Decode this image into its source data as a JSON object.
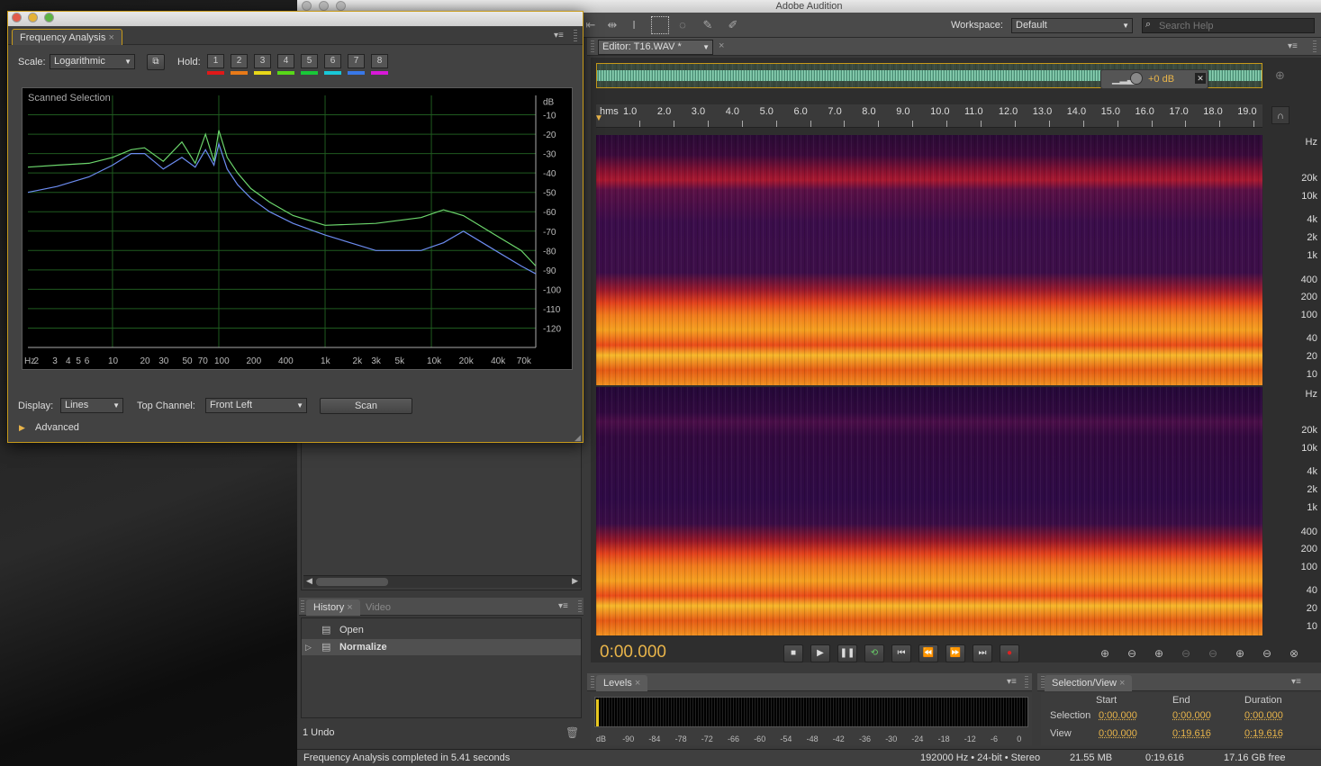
{
  "app": {
    "title": "Adobe Audition"
  },
  "toolbar": {
    "workspace_label": "Workspace:",
    "workspace_value": "Default",
    "search_placeholder": "Search Help"
  },
  "freq": {
    "title": "Frequency Analysis",
    "scale_label": "Scale:",
    "scale_value": "Logarithmic",
    "hold_label": "Hold:",
    "holds": [
      {
        "n": "1",
        "color": "#e01818"
      },
      {
        "n": "2",
        "color": "#e87a18"
      },
      {
        "n": "3",
        "color": "#e8d818"
      },
      {
        "n": "4",
        "color": "#58d818"
      },
      {
        "n": "5",
        "color": "#18c838"
      },
      {
        "n": "6",
        "color": "#18c8d8"
      },
      {
        "n": "7",
        "color": "#3878e8"
      },
      {
        "n": "8",
        "color": "#d818d8"
      }
    ],
    "graph_caption": "Scanned Selection",
    "display_label": "Display:",
    "display_value": "Lines",
    "top_channel_label": "Top Channel:",
    "top_channel_value": "Front Left",
    "scan_label": "Scan",
    "advanced_label": "Advanced"
  },
  "chart_data": {
    "type": "line",
    "title": "Scanned Selection",
    "xlabel": "Hz",
    "ylabel": "dB",
    "xscale": "log",
    "xlim": [
      1.6,
      96000
    ],
    "ylim": [
      -130,
      0
    ],
    "x_ticks": [
      "Hz",
      "2",
      "3",
      "4",
      "5",
      "6",
      "10",
      "20",
      "30",
      "50",
      "70",
      "100",
      "200",
      "400",
      "1k",
      "2k",
      "3k",
      "5k",
      "10k",
      "20k",
      "40k",
      "70k"
    ],
    "y_ticks": [
      "dB",
      "-10",
      "-20",
      "-30",
      "-40",
      "-50",
      "-60",
      "-70",
      "-80",
      "-90",
      "-100",
      "-110",
      "-120"
    ],
    "series": [
      {
        "color": "#6cd66c",
        "x": [
          1.6,
          3,
          6,
          10,
          15,
          20,
          30,
          45,
          60,
          75,
          90,
          100,
          120,
          150,
          200,
          300,
          500,
          1000,
          3000,
          8000,
          13000,
          20000,
          40000,
          70000,
          96000
        ],
        "y": [
          -37,
          -36,
          -35,
          -32,
          -28,
          -27,
          -34,
          -24,
          -35,
          -20,
          -34,
          -18,
          -32,
          -40,
          -48,
          -55,
          -62,
          -67,
          -66,
          -63,
          -59,
          -62,
          -72,
          -80,
          -88
        ]
      },
      {
        "color": "#6c8cf0",
        "x": [
          1.6,
          3,
          6,
          10,
          15,
          20,
          30,
          45,
          60,
          75,
          90,
          100,
          120,
          150,
          200,
          300,
          500,
          1000,
          3000,
          8000,
          13000,
          20000,
          40000,
          70000,
          96000
        ],
        "y": [
          -50,
          -47,
          -42,
          -36,
          -30,
          -30,
          -38,
          -32,
          -37,
          -28,
          -36,
          -25,
          -38,
          -46,
          -53,
          -60,
          -66,
          -72,
          -80,
          -80,
          -76,
          -70,
          -80,
          -88,
          -92
        ]
      }
    ]
  },
  "history": {
    "tabs": [
      "History",
      "Video"
    ],
    "items": [
      "Open",
      "Normalize"
    ],
    "undo_text": "1 Undo"
  },
  "editor": {
    "tab_label": "Editor: T16.WAV *",
    "gain_text": "+0 dB",
    "ruler_unit": "hms",
    "ruler_ticks": [
      "1.0",
      "2.0",
      "3.0",
      "4.0",
      "5.0",
      "6.0",
      "7.0",
      "8.0",
      "9.0",
      "10.0",
      "11.0",
      "12.0",
      "13.0",
      "14.0",
      "15.0",
      "16.0",
      "17.0",
      "18.0",
      "19.0"
    ],
    "hz_ticks": [
      "Hz",
      "20k",
      "10k",
      "4k",
      "2k",
      "1k",
      "400",
      "200",
      "100",
      "40",
      "20",
      "10"
    ],
    "current_time": "0:00.000"
  },
  "levels": {
    "title": "Levels",
    "ticks": [
      "dB",
      "-90",
      "-84",
      "-78",
      "-72",
      "-66",
      "-60",
      "-54",
      "-48",
      "-42",
      "-36",
      "-30",
      "-24",
      "-18",
      "-12",
      "-6",
      "0"
    ]
  },
  "selview": {
    "title": "Selection/View",
    "col_start": "Start",
    "col_end": "End",
    "col_duration": "Duration",
    "row_selection": "Selection",
    "row_view": "View",
    "sel_start": "0:00.000",
    "sel_end": "0:00.000",
    "sel_duration": "0:00.000",
    "view_start": "0:00.000",
    "view_end": "0:19.616",
    "view_duration": "0:19.616"
  },
  "status": {
    "message": "Frequency Analysis completed in 5.41 seconds",
    "format": "192000 Hz • 24-bit • Stereo",
    "size": "21.55 MB",
    "duration": "0:19.616",
    "free": "17.16 GB free"
  }
}
